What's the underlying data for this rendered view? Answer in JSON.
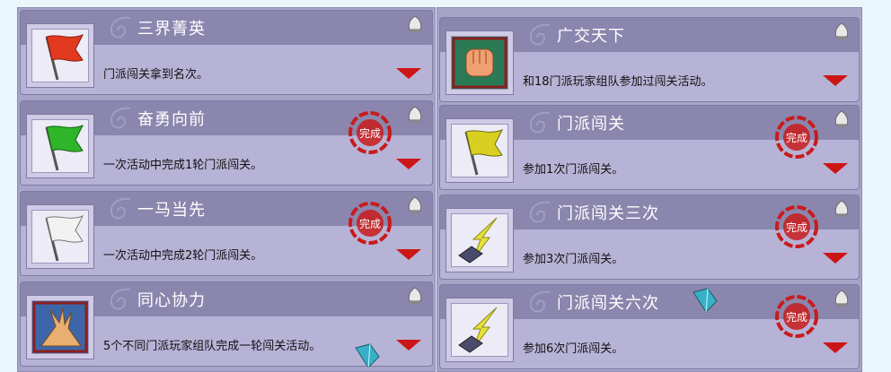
{
  "left": [
    {
      "title": "三界菁英",
      "desc": "门派闯关拿到名次。",
      "completed": false,
      "icon": "red-flag-icon"
    },
    {
      "title": "奋勇向前",
      "desc": "一次活动中完成1轮门派闯关。",
      "completed": true,
      "icon": "green-flag-icon"
    },
    {
      "title": "一马当先",
      "desc": "一次活动中完成2轮门派闯关。",
      "completed": true,
      "icon": "white-flag-icon"
    },
    {
      "title": "同心协力",
      "desc": "5个不同门派玩家组队完成一轮闯关活动。",
      "completed": false,
      "icon": "hands-icon"
    }
  ],
  "right": [
    {
      "title": "广交天下",
      "desc": "和18门派玩家组队参加过闯关活动。",
      "completed": false,
      "icon": "fist-icon"
    },
    {
      "title": "门派闯关",
      "desc": "参加1次门派闯关。",
      "completed": true,
      "icon": "yellow-flag-icon"
    },
    {
      "title": "门派闯关三次",
      "desc": "参加3次门派闯关。",
      "completed": true,
      "icon": "lightning-anvil-icon"
    },
    {
      "title": "门派闯关六次",
      "desc": "参加6次门派闯关。",
      "completed": true,
      "icon": "lightning-anvil-icon"
    }
  ],
  "stamp_text": "完成",
  "colors": {
    "panel": "#a7a4c7",
    "header": "#8a86ad",
    "body": "#b7b3d6",
    "stamp": "#c81b1b",
    "arrow": "#cc1616"
  }
}
